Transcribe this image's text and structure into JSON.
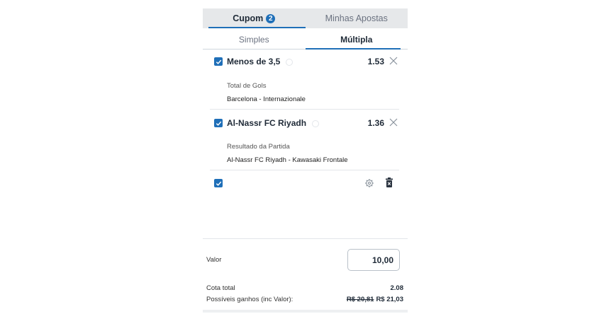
{
  "top_tabs": {
    "cupom_label": "Cupom",
    "cupom_badge": "2",
    "minhas_apostas_label": "Minhas Apostas"
  },
  "sub_tabs": {
    "simples_label": "Simples",
    "multipla_label": "Múltipla"
  },
  "selections": [
    {
      "name": "Menos de 3,5",
      "odd": "1.53",
      "market": "Total de Gols",
      "match": "Barcelona - Internazionale"
    },
    {
      "name": "Al-Nassr FC Riyadh",
      "odd": "1.36",
      "market": "Resultado da Partida",
      "match": "Al-Nassr FC Riyadh - Kawasaki Frontale"
    }
  ],
  "footer": {
    "valor_label": "Valor",
    "valor_value": "10,00",
    "cota_label": "Cota total",
    "cota_value": "2.08",
    "ganhos_label": "Possíveis ganhos (inc Valor):",
    "ganhos_old": "R$ 20,81",
    "ganhos_new": "R$ 21,03"
  },
  "colors": {
    "accent": "#1f6fb8",
    "tab_bg": "#e6e8ea"
  },
  "icons": {
    "check": "check-icon",
    "close": "close-icon",
    "info": "info-icon",
    "settings": "gear-icon",
    "delete": "trash-icon"
  }
}
